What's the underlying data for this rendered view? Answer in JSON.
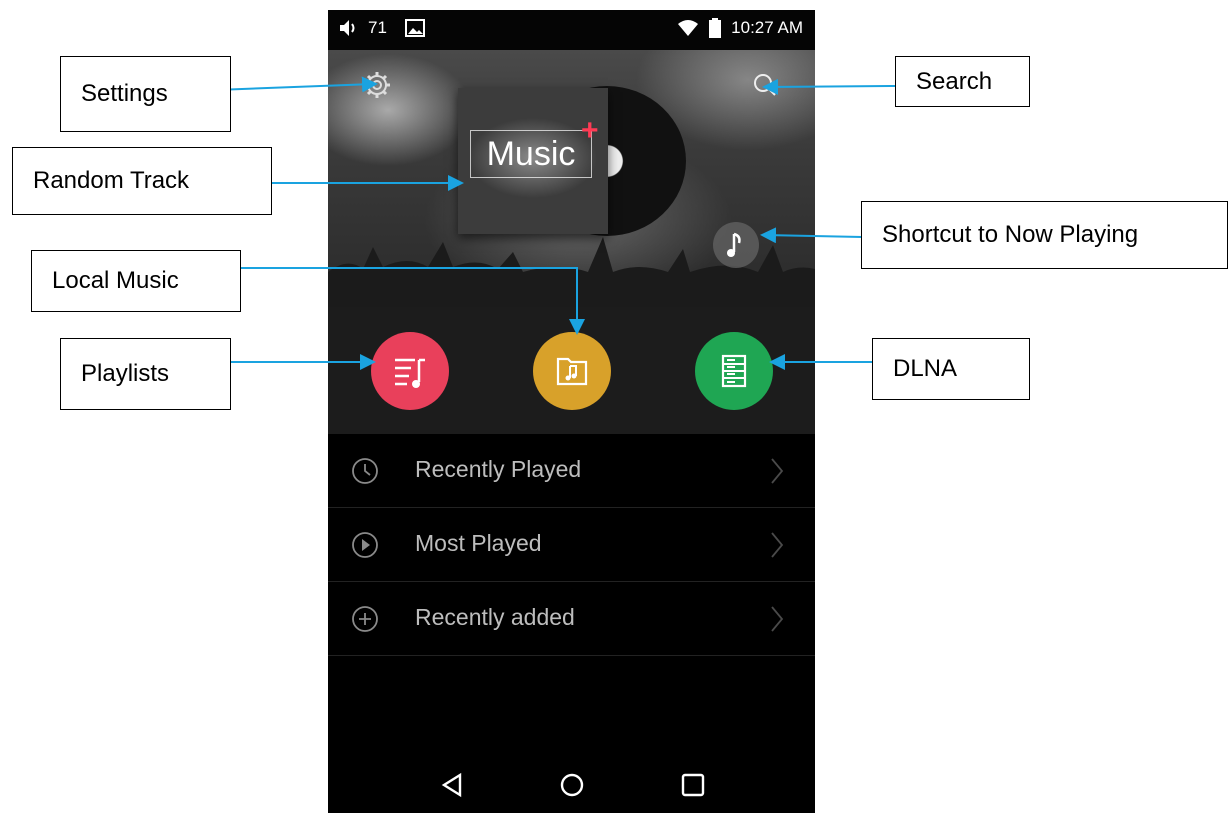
{
  "status_bar": {
    "volume": "71",
    "time": "10:27 AM",
    "icons": [
      "volume-icon",
      "image-icon",
      "wifi-icon",
      "battery-icon"
    ]
  },
  "hero": {
    "album_text": "Music",
    "album_badge": "+"
  },
  "categories": [
    {
      "name": "playlists",
      "icon": "playlist-icon",
      "color": "#e9405b"
    },
    {
      "name": "local-music",
      "icon": "music-folder-icon",
      "color": "#d8a12a"
    },
    {
      "name": "dlna",
      "icon": "server-icon",
      "color": "#1fa653"
    }
  ],
  "list_items": [
    {
      "label": "Recently Played",
      "icon": "clock-icon"
    },
    {
      "label": "Most Played",
      "icon": "play-circle-icon"
    },
    {
      "label": "Recently added",
      "icon": "plus-circle-icon"
    }
  ],
  "nav": [
    "back-icon",
    "home-icon",
    "recents-icon"
  ],
  "callouts": {
    "settings": "Settings",
    "search": "Search",
    "random_track": "Random Track",
    "shortcut_now_playing": "Shortcut to Now Playing",
    "local_music": "Local Music",
    "playlists": "Playlists",
    "dlna": "DLNA"
  },
  "colors": {
    "accent_line": "#1aa3e0",
    "playlists": "#e9405b",
    "local_music": "#d8a12a",
    "dlna": "#1fa653",
    "badge": "#ff3b55"
  }
}
